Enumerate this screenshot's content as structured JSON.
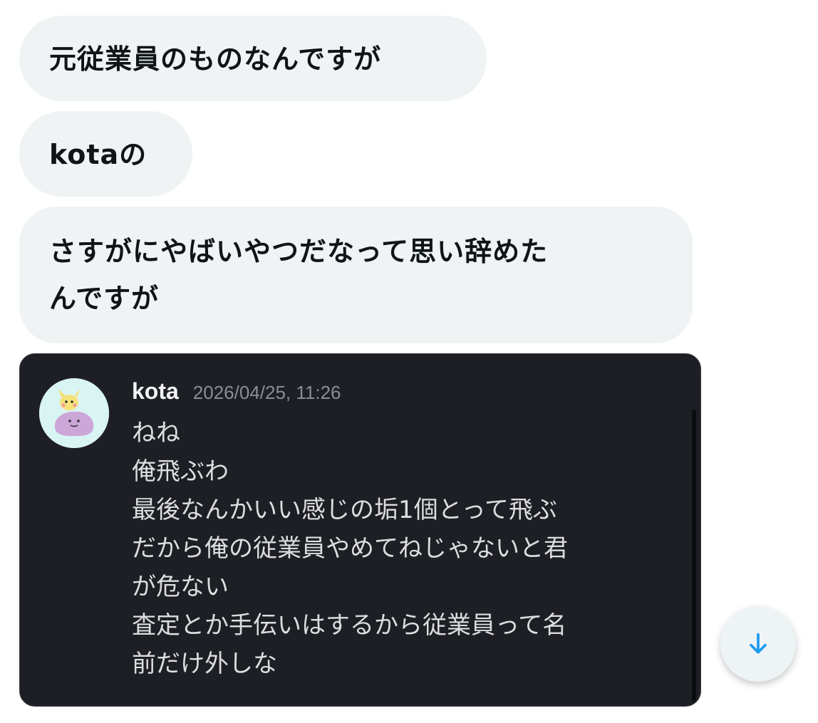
{
  "messages": [
    {
      "text": "元従業員のものなんですが"
    },
    {
      "text": "kotaの"
    },
    {
      "lines": [
        "さすがにやばいやつだなって思い辞めた",
        "んですが"
      ]
    }
  ],
  "embed": {
    "author": "kota",
    "timestamp": "2026/04/25, 11:26",
    "avatar_icon": "avatar-icon",
    "lines": [
      "ねね",
      "俺飛ぶわ",
      "最後なんかいい感じの垢1個とって飛ぶ",
      "だから俺の従業員やめてねじゃないと君",
      "が危ない",
      "査定とか手伝いはするから従業員って名",
      "前だけ外しな"
    ]
  },
  "scroll_button": {
    "icon": "arrow-down-icon",
    "color": "#1d9bf0"
  }
}
